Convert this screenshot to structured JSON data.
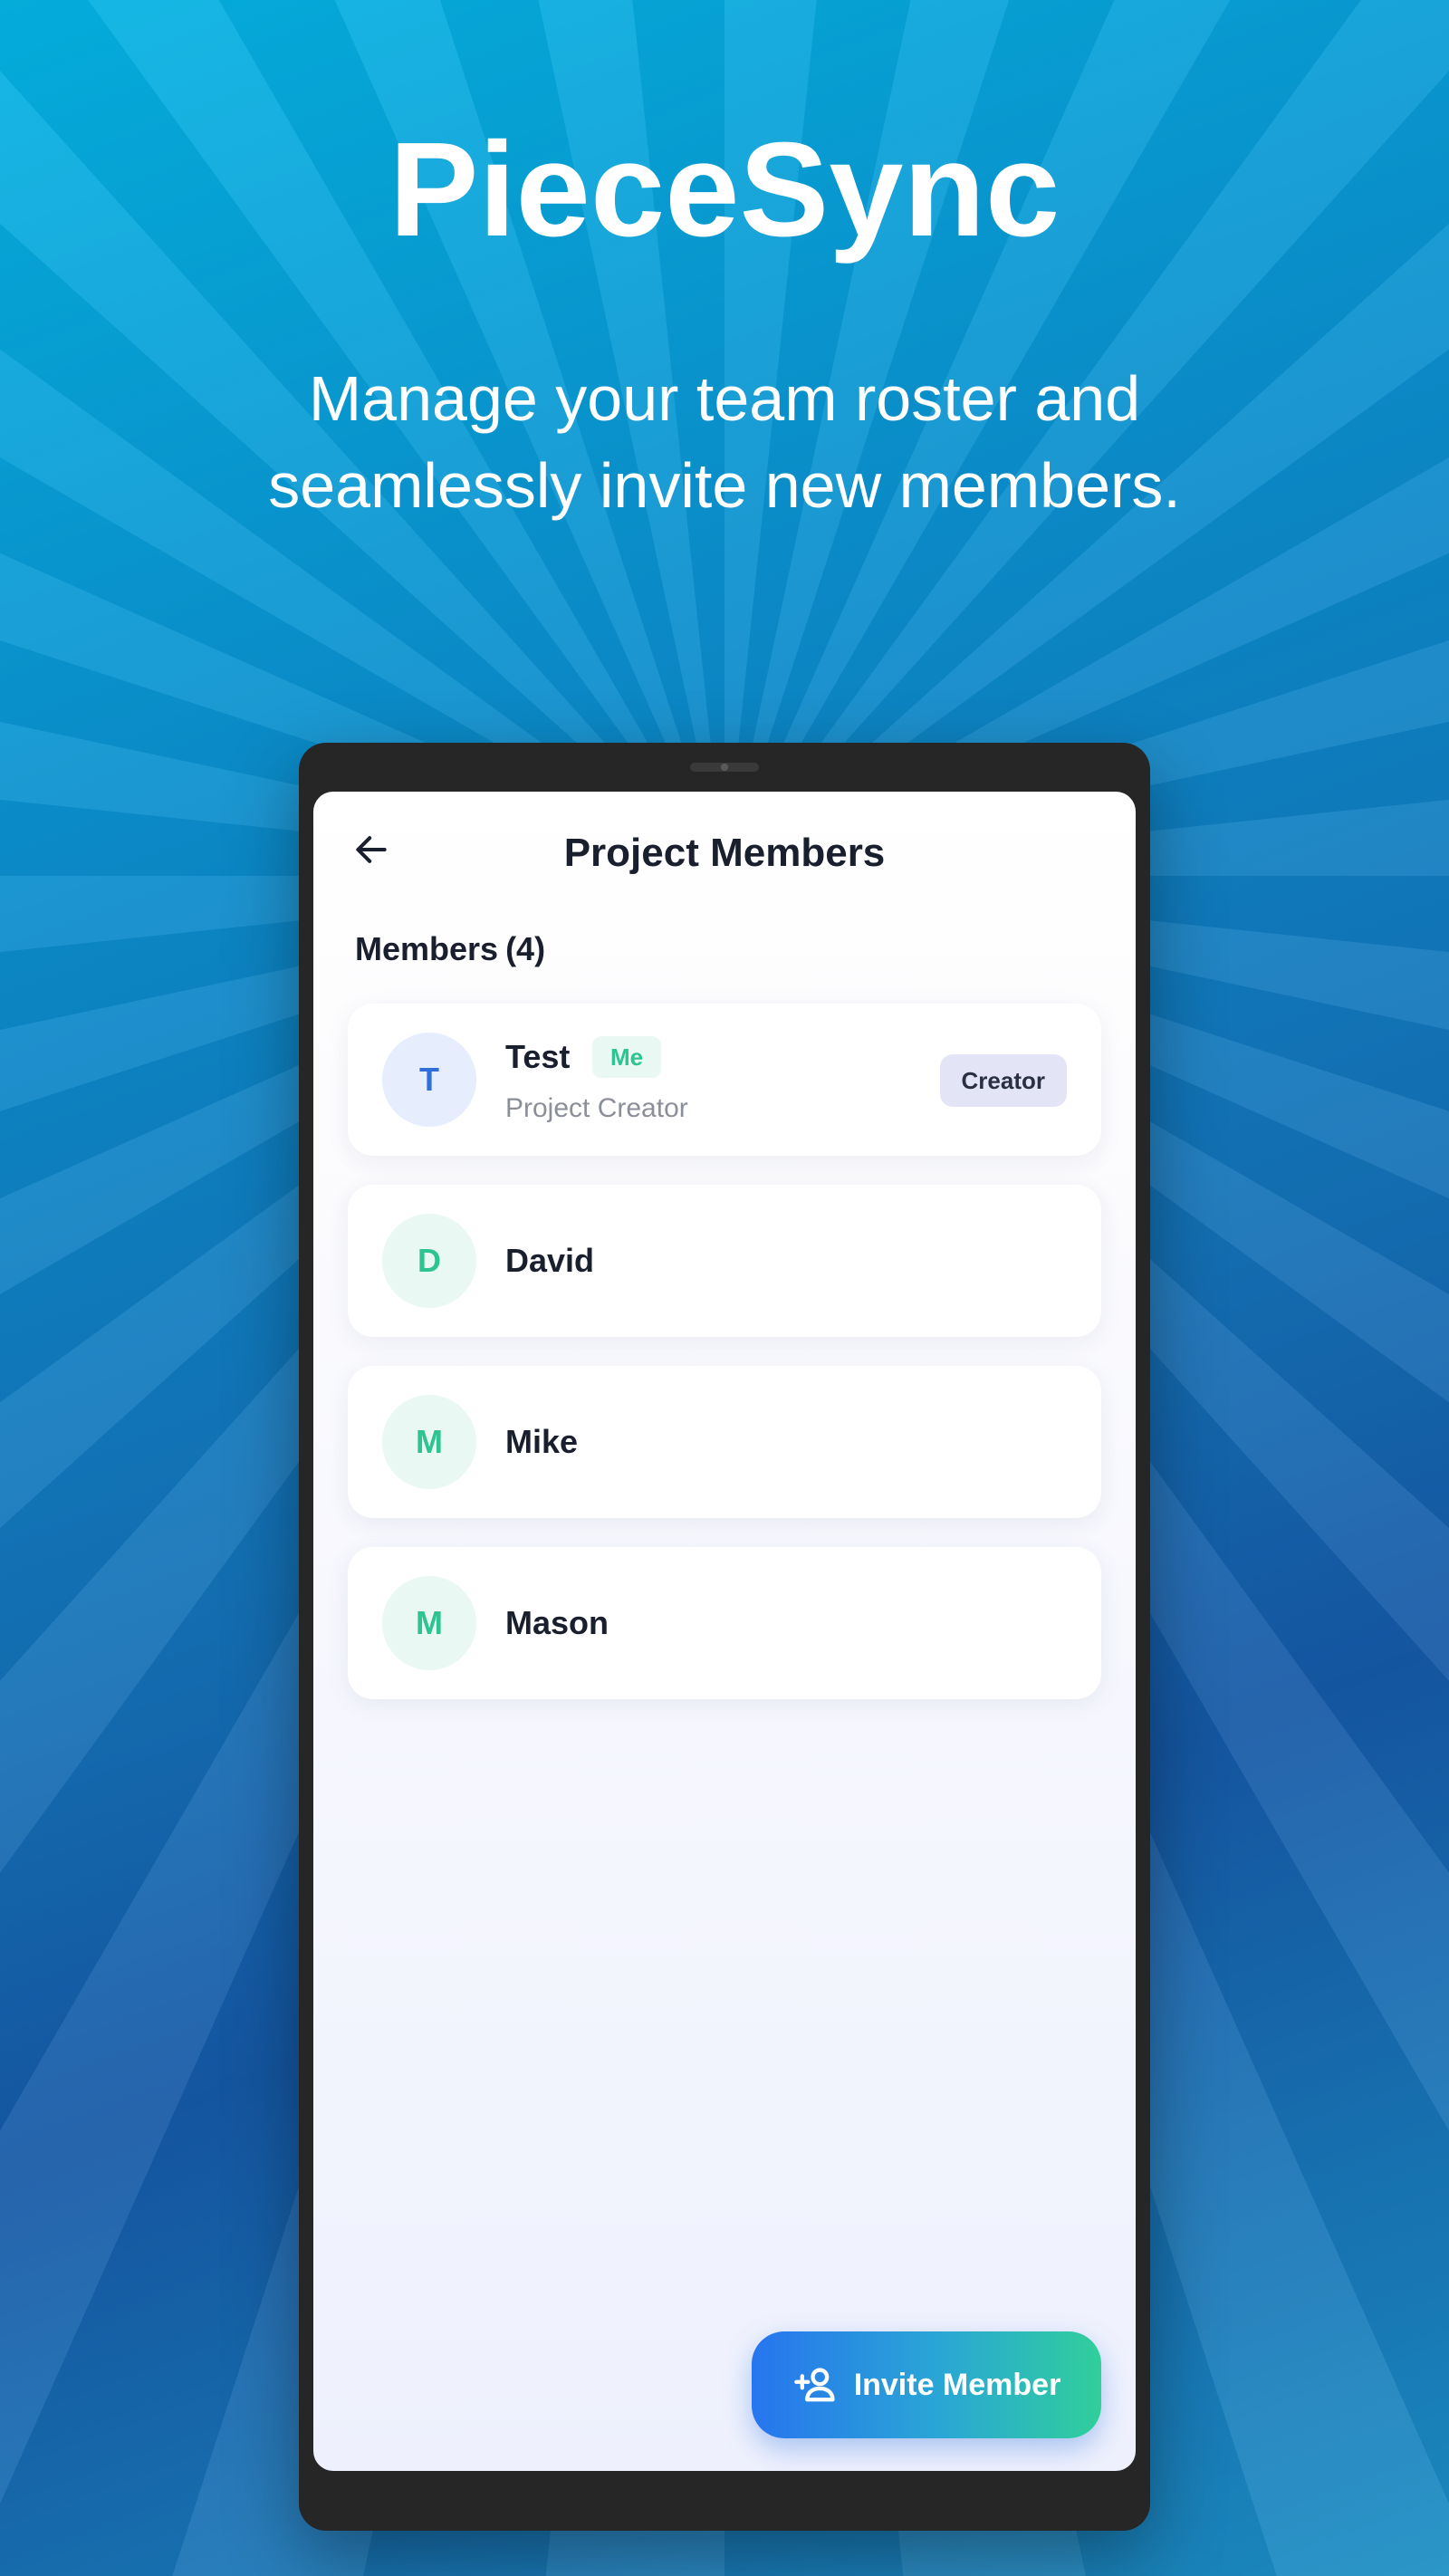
{
  "hero": {
    "title": "PieceSync",
    "subtitle": "Manage your team roster and seamlessly invite new members."
  },
  "screen": {
    "title": "Project Members",
    "back_icon": "arrow-left-icon",
    "section_label": "Members",
    "member_count": "(4)"
  },
  "members": [
    {
      "initial": "T",
      "name": "Test",
      "me_label": "Me",
      "role": "Project Creator",
      "badge": "Creator",
      "avatar_color": "#2f6fdc"
    },
    {
      "initial": "D",
      "name": "David",
      "avatar_color": "#2ec492"
    },
    {
      "initial": "M",
      "name": "Mike",
      "avatar_color": "#2ec492"
    },
    {
      "initial": "M",
      "name": "Mason",
      "avatar_color": "#2ec492"
    }
  ],
  "invite_button": {
    "label": "Invite Member",
    "icon": "person-add-icon"
  },
  "colors": {
    "accent_blue": "#2775ee",
    "accent_green": "#30cf9b",
    "text_dark": "#1a1f2e"
  }
}
